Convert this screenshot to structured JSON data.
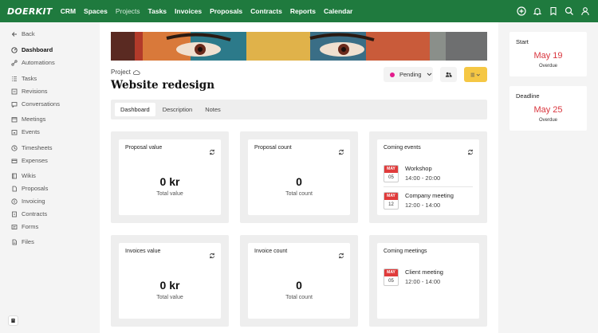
{
  "nav": {
    "logo": "DOERKIT",
    "links": [
      "CRM",
      "Spaces",
      "Projects",
      "Tasks",
      "Invoices",
      "Proposals",
      "Contracts",
      "Reports",
      "Calendar"
    ],
    "active_link": "Projects"
  },
  "sidebar": {
    "items": [
      {
        "label": "Back",
        "icon": "arrow-left-icon"
      },
      {
        "label": "Dashboard",
        "icon": "dashboard-icon"
      },
      {
        "label": "Automations",
        "icon": "automations-icon"
      },
      {
        "label": "Tasks",
        "icon": "tasks-icon"
      },
      {
        "label": "Revisions",
        "icon": "revisions-icon"
      },
      {
        "label": "Conversations",
        "icon": "conversations-icon"
      },
      {
        "label": "Meetings",
        "icon": "meetings-icon"
      },
      {
        "label": "Events",
        "icon": "events-icon"
      },
      {
        "label": "Timesheets",
        "icon": "clock-icon"
      },
      {
        "label": "Expenses",
        "icon": "expenses-icon"
      },
      {
        "label": "Wikis",
        "icon": "wiki-icon"
      },
      {
        "label": "Proposals",
        "icon": "proposal-icon"
      },
      {
        "label": "Invoicing",
        "icon": "invoice-icon"
      },
      {
        "label": "Contracts",
        "icon": "contract-icon"
      },
      {
        "label": "Forms",
        "icon": "form-icon"
      },
      {
        "label": "Files",
        "icon": "file-icon"
      }
    ]
  },
  "project": {
    "crumb": "Project",
    "title": "Website redesign",
    "status": "Pending",
    "status_color": "#e31b8c"
  },
  "tabs": [
    "Dashboard",
    "Description",
    "Notes"
  ],
  "cards": {
    "proposal_value": {
      "title": "Proposal value",
      "value": "0 kr",
      "caption": "Total value"
    },
    "proposal_count": {
      "title": "Proposal count",
      "value": "0",
      "caption": "Total count"
    },
    "invoices_value": {
      "title": "Invoices value",
      "value": "0 kr",
      "caption": "Total value"
    },
    "invoice_count": {
      "title": "Invoice count",
      "value": "0",
      "caption": "Total count"
    },
    "coming_events": {
      "title": "Coming events",
      "items": [
        {
          "month": "MAY",
          "day": "05",
          "name": "Workshop",
          "time": "14:00 - 20:00"
        },
        {
          "month": "MAY",
          "day": "12",
          "name": "Company meeting",
          "time": "12:00 - 14:00"
        }
      ]
    },
    "coming_meetings": {
      "title": "Coming meetings",
      "items": [
        {
          "month": "MAY",
          "day": "05",
          "name": "Client meeting",
          "time": "12:00 - 14:00"
        }
      ]
    }
  },
  "right": {
    "start": {
      "label": "Start",
      "date": "May 19",
      "sub": "Overdue"
    },
    "deadline": {
      "label": "Deadline",
      "date": "May 25",
      "sub": "Overdue"
    }
  },
  "colors": {
    "brand": "#1f7a3e",
    "accent": "#f5c744",
    "danger": "#d9363e"
  }
}
